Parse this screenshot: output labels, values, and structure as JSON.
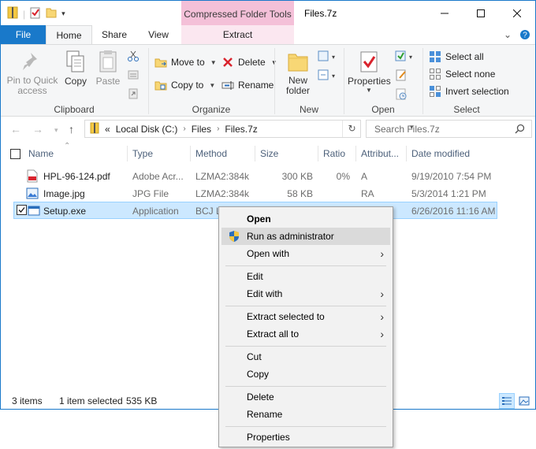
{
  "title": {
    "window_title": "Files.7z",
    "context_tab": "Compressed Folder Tools"
  },
  "tabs": {
    "file": "File",
    "home": "Home",
    "share": "Share",
    "view": "View",
    "extract": "Extract"
  },
  "ribbon": {
    "clipboard": {
      "pin": "Pin to Quick access",
      "copy": "Copy",
      "paste": "Paste",
      "label": "Clipboard"
    },
    "organize": {
      "move_to": "Move to",
      "copy_to": "Copy to",
      "delete": "Delete",
      "rename": "Rename",
      "label": "Organize"
    },
    "new": {
      "new_folder": "New folder",
      "label": "New"
    },
    "open": {
      "properties": "Properties",
      "label": "Open"
    },
    "select": {
      "select_all": "Select all",
      "select_none": "Select none",
      "invert": "Invert selection",
      "label": "Select"
    }
  },
  "address": {
    "prefix": "«",
    "crumbs": [
      "Local Disk (C:)",
      "Files",
      "Files.7z"
    ],
    "search_placeholder": "Search Files.7z"
  },
  "columns": [
    "Name",
    "Type",
    "Method",
    "Size",
    "Ratio",
    "Attribut...",
    "Date modified"
  ],
  "files": [
    {
      "name": "HPL-96-124.pdf",
      "type": "Adobe Acr...",
      "method": "LZMA2:384k",
      "size": "300 KB",
      "ratio": "0%",
      "attr": "A",
      "date": "9/19/2010 7:54 PM"
    },
    {
      "name": "Image.jpg",
      "type": "JPG File",
      "method": "LZMA2:384k",
      "size": "58 KB",
      "ratio": "",
      "attr": "RA",
      "date": "5/3/2014 1:21 PM"
    },
    {
      "name": "Setup.exe",
      "type": "Application",
      "method": "BCJ LZ",
      "size": "",
      "ratio": "",
      "attr": "",
      "date": "6/26/2016 11:16 AM"
    }
  ],
  "status": {
    "items": "3 items",
    "selected": "1 item selected",
    "size": "535 KB"
  },
  "context_menu": {
    "open": "Open",
    "run_as_admin": "Run as administrator",
    "open_with": "Open with",
    "edit": "Edit",
    "edit_with": "Edit with",
    "extract_selected_to": "Extract selected to",
    "extract_all_to": "Extract all to",
    "cut": "Cut",
    "copy": "Copy",
    "delete": "Delete",
    "rename": "Rename",
    "properties": "Properties"
  },
  "colors": {
    "accent": "#1979ca",
    "context_tab": "#f4c0d8",
    "selection": "#cce8ff"
  }
}
